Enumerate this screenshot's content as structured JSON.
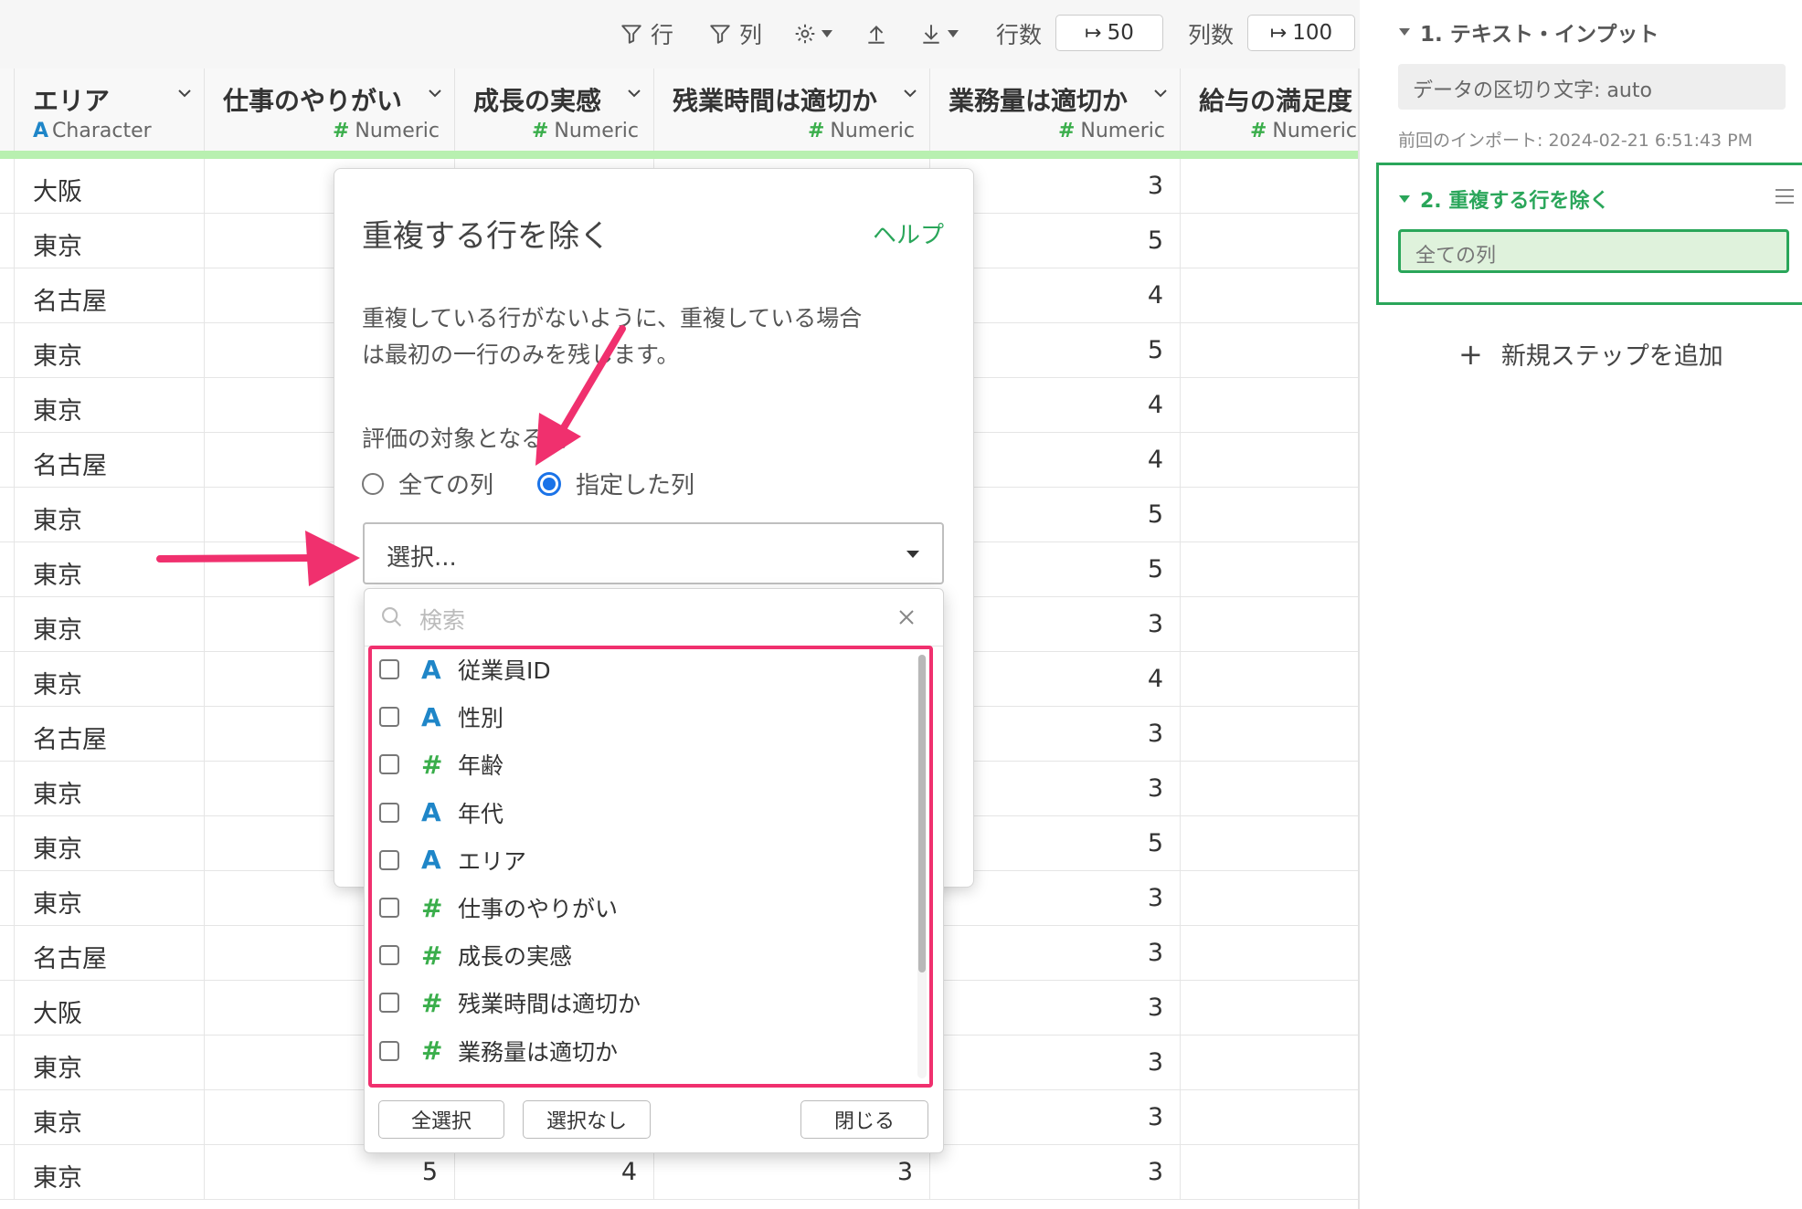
{
  "toolbar": {
    "row_filter": "行",
    "col_filter": "列",
    "rows_label": "行数",
    "rows_value": "50",
    "cols_label": "列数",
    "cols_value": "100"
  },
  "columns": [
    {
      "name": "エリア",
      "type": "Character",
      "kind": "char"
    },
    {
      "name": "仕事のやりがい",
      "type": "Numeric",
      "kind": "num"
    },
    {
      "name": "成長の実感",
      "type": "Numeric",
      "kind": "num"
    },
    {
      "name": "残業時間は適切か",
      "type": "Numeric",
      "kind": "num"
    },
    {
      "name": "業務量は適切か",
      "type": "Numeric",
      "kind": "num"
    },
    {
      "name": "給与の満足度",
      "type": "Numeric",
      "kind": "num"
    }
  ],
  "rows": [
    {
      "area": "大阪",
      "v": "3"
    },
    {
      "area": "東京",
      "v": "5"
    },
    {
      "area": "名古屋",
      "v": "4"
    },
    {
      "area": "東京",
      "v": "5"
    },
    {
      "area": "東京",
      "v": "4"
    },
    {
      "area": "名古屋",
      "v": "4"
    },
    {
      "area": "東京",
      "v": "5"
    },
    {
      "area": "東京",
      "v": "5"
    },
    {
      "area": "東京",
      "v": "3"
    },
    {
      "area": "東京",
      "v": "4"
    },
    {
      "area": "名古屋",
      "v": "3"
    },
    {
      "area": "東京",
      "v": "3"
    },
    {
      "area": "東京",
      "v": "5"
    },
    {
      "area": "東京",
      "v": "3"
    },
    {
      "area": "名古屋",
      "v": "3"
    },
    {
      "area": "大阪",
      "v": "3"
    },
    {
      "area": "東京",
      "v": "3"
    },
    {
      "area": "東京",
      "v": "3"
    },
    {
      "area": "東京",
      "v": "3",
      "c1": "5",
      "c2": "4",
      "c3": "3"
    }
  ],
  "panel": {
    "step1_title": "1. テキスト・インプット",
    "step1_detail": "データの区切り文字: auto",
    "step1_meta": "前回のインポート: 2024-02-21 6:51:43 PM",
    "step2_title": "2. 重複する行を除く",
    "step2_value": "全ての列",
    "add_step": "新規ステップを追加"
  },
  "modal": {
    "title": "重複する行を除く",
    "help": "ヘルプ",
    "desc_line1": "重複している行がないように、重複している場合",
    "desc_line2": "は最初の一行のみを残します。",
    "target_label": "評価の対象となる列",
    "radio_all": "全ての列",
    "radio_selected": "指定した列",
    "select_placeholder": "選択..."
  },
  "dropdown": {
    "search_placeholder": "検索",
    "options": [
      {
        "label": "従業員ID",
        "kind": "char"
      },
      {
        "label": "性別",
        "kind": "char"
      },
      {
        "label": "年齢",
        "kind": "num"
      },
      {
        "label": "年代",
        "kind": "char"
      },
      {
        "label": "エリア",
        "kind": "char"
      },
      {
        "label": "仕事のやりがい",
        "kind": "num"
      },
      {
        "label": "成長の実感",
        "kind": "num"
      },
      {
        "label": "残業時間は適切か",
        "kind": "num"
      },
      {
        "label": "業務量は適切か",
        "kind": "num"
      }
    ],
    "select_all": "全選択",
    "select_none": "選択なし",
    "close": "閉じる"
  },
  "colors": {
    "accent_green": "#2aa65a",
    "highlight_pink": "#f0306e",
    "radio_blue": "#1a73e8",
    "char_icon": "#1f86c8",
    "num_icon": "#3aae4b"
  }
}
